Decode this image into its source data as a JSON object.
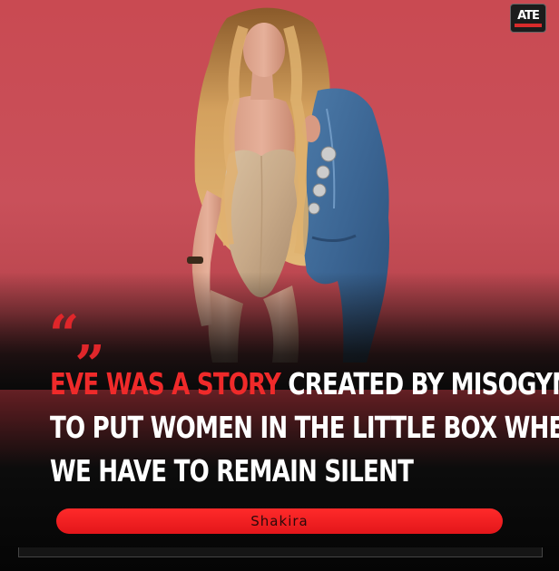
{
  "logo": {
    "mark": "ATE"
  },
  "quote": {
    "mark": "“„",
    "highlight": "EVE WAS A STORY",
    "line1_rest": " CREATED BY MISOGYNISTS",
    "line2": "TO PUT WOMEN IN THE LITTLE BOX WHERE",
    "line3": "WE HAVE TO REMAIN SILENT"
  },
  "author": "Shakira",
  "colors": {
    "accent": "#e8262a",
    "wall": "#c94a52",
    "text": "#ffffff"
  }
}
